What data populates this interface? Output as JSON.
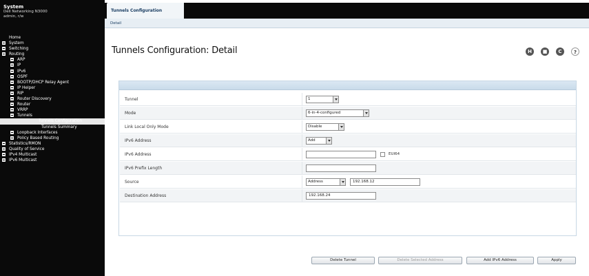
{
  "sidebar": {
    "title": "System",
    "subtitle_line1": "Dell Networking N3000",
    "subtitle_line2": "admin, r/w",
    "tree": [
      {
        "label": "Home",
        "level": 0,
        "expander": false
      },
      {
        "label": "System",
        "level": 0,
        "expander": true
      },
      {
        "label": "Switching",
        "level": 0,
        "expander": true
      },
      {
        "label": "Routing",
        "level": 0,
        "expander": true
      },
      {
        "label": "ARP",
        "level": 1,
        "expander": true
      },
      {
        "label": "IP",
        "level": 1,
        "expander": true
      },
      {
        "label": "IPv6",
        "level": 1,
        "expander": true
      },
      {
        "label": "OSPF",
        "level": 1,
        "expander": true
      },
      {
        "label": "BOOTP/DHCP Relay Agent",
        "level": 1,
        "expander": true
      },
      {
        "label": "IP Helper",
        "level": 1,
        "expander": true
      },
      {
        "label": "RIP",
        "level": 1,
        "expander": true
      },
      {
        "label": "Router Discovery",
        "level": 1,
        "expander": true
      },
      {
        "label": "Router",
        "level": 1,
        "expander": true
      },
      {
        "label": "VRRP",
        "level": 1,
        "expander": true
      },
      {
        "label": "Tunnels",
        "level": 1,
        "expander": true
      },
      {
        "label": "Tunnels Configuration",
        "level": 2,
        "expander": false,
        "selected": true
      },
      {
        "label": "Tunnels Summary",
        "level": 2,
        "expander": false
      },
      {
        "label": "Loopback Interfaces",
        "level": 1,
        "expander": true
      },
      {
        "label": "Policy Based Routing",
        "level": 1,
        "expander": true
      },
      {
        "label": "Statistics/RMON",
        "level": 0,
        "expander": true
      },
      {
        "label": "Quality of Service",
        "level": 0,
        "expander": true
      },
      {
        "label": "IPv4 Multicast",
        "level": 0,
        "expander": true
      },
      {
        "label": "IPv6 Multicast",
        "level": 0,
        "expander": true
      }
    ]
  },
  "header": {
    "tab_label": "Tunnels Configuration",
    "subtab_label": "Detail"
  },
  "page": {
    "title": "Tunnels Configuration: Detail",
    "icons": [
      "save-icon",
      "print-icon",
      "refresh-icon",
      "help-icon"
    ],
    "icon_glyphs": {
      "save": "H",
      "print": "■",
      "refresh": "C",
      "help": "?"
    }
  },
  "form": {
    "tunnel": {
      "label": "Tunnel",
      "value": "1"
    },
    "mode": {
      "label": "Mode",
      "value": "6-in-4-configured"
    },
    "link_local": {
      "label": "Link Local Only Mode",
      "value": "Disable"
    },
    "ipv6_address_type": {
      "label": "IPv6 Address",
      "value": "Add"
    },
    "ipv6_address": {
      "label": "IPv6 Address",
      "value": "",
      "checkbox_label": "EUI64"
    },
    "ipv6_prefix": {
      "label": "IPv6 Prefix Length",
      "value": ""
    },
    "source": {
      "label": "Source",
      "type": "Address",
      "value": "192.168.12"
    },
    "destination": {
      "label": "Destination Address",
      "value": "192.168.24"
    }
  },
  "buttons": {
    "delete": "Delete Tunnel",
    "delete_ipv6": "Delete Selected Address",
    "add_ipv6": "Add IPv6 Address",
    "apply": "Apply"
  }
}
